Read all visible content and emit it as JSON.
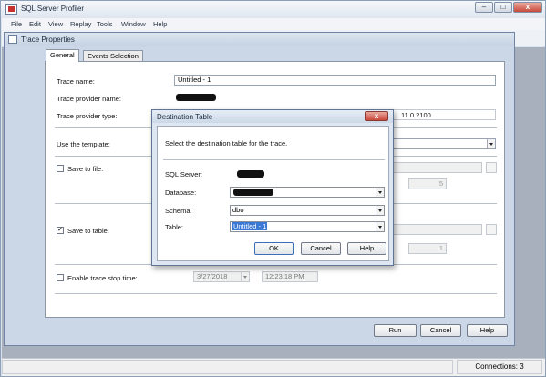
{
  "app": {
    "title": "SQL Server Profiler",
    "menu": [
      "File",
      "Edit",
      "View",
      "Replay",
      "Tools",
      "Window",
      "Help"
    ],
    "caption_minimize": "–",
    "caption_maximize": "□",
    "caption_close": "x",
    "status_connections": "Connections: 3"
  },
  "trace_properties": {
    "title": "Trace Properties",
    "tabs": [
      "General",
      "Events Selection"
    ],
    "fields": {
      "trace_name_label": "Trace name:",
      "trace_name_value": "Untitled - 1",
      "provider_name_label": "Trace provider name:",
      "provider_type_label": "Trace provider type:",
      "provider_version": "11.0.2100",
      "use_template_label": "Use the template:",
      "save_to_file_label": "Save to file:",
      "save_to_file_checked": false,
      "file_rollover_value": "5",
      "save_to_table_label": "Save to table:",
      "save_to_table_checked": true,
      "table_rows_value": "1",
      "stop_time_label": "Enable trace stop time:",
      "stop_time_checked": false,
      "stop_date": "3/27/2018",
      "stop_time": "12:23:18 PM"
    },
    "buttons": {
      "run": "Run",
      "cancel": "Cancel",
      "help": "Help"
    }
  },
  "destination_dialog": {
    "title": "Destination Table",
    "close": "x",
    "instructions": "Select the destination table for the trace.",
    "server_label": "SQL Server:",
    "database_label": "Database:",
    "schema_label": "Schema:",
    "schema_value": "dbo",
    "table_label": "Table:",
    "table_value": "Untitled - 1",
    "buttons": {
      "ok": "OK",
      "cancel": "Cancel",
      "help": "Help"
    }
  },
  "colors": {
    "titlebar": "#dfe6f0",
    "dialog_bg": "#dde6f1",
    "selection": "#3a78d6",
    "close_button": "#c7493a"
  }
}
